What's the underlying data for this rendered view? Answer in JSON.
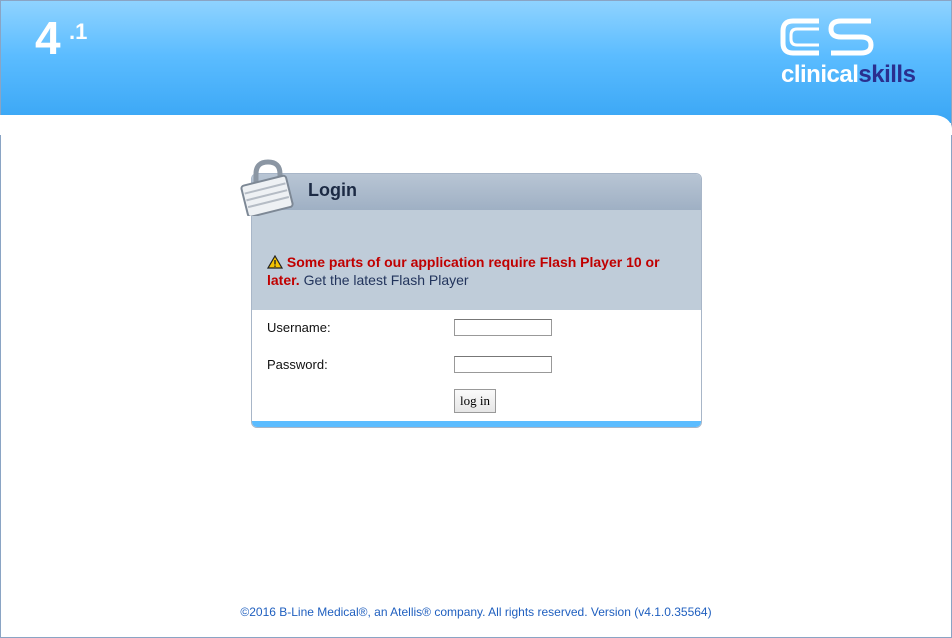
{
  "header": {
    "version_major": "4",
    "version_minor": ".1",
    "brand_white": "clinical",
    "brand_blue": "skills",
    "brand_mark": "CS"
  },
  "login": {
    "title": "Login",
    "warning_bold": "Some parts of our application require Flash Player 10 or later.",
    "warning_link": "Get the latest Flash Player",
    "username_label": "Username:",
    "password_label": "Password:",
    "username_value": "",
    "password_value": "",
    "button_label": "log in"
  },
  "footer": {
    "text": "©2016 B-Line Medical®, an Atellis® company. All rights reserved. Version (v4.1.0.35564)"
  },
  "colors": {
    "header_top": "#8fd3ff",
    "header_bottom": "#39a6f5",
    "warning_red": "#c00000",
    "brand_blue": "#2a2f8f",
    "footer_text": "#1f5fbf"
  }
}
